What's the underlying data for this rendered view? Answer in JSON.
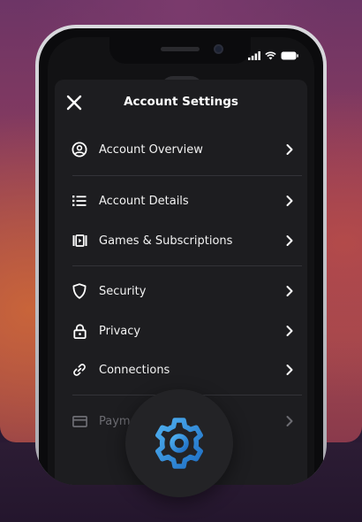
{
  "screen": {
    "title": "Account Settings",
    "menu": [
      {
        "label": "Account Overview",
        "icon": "account-circle-icon"
      },
      {
        "label": "Account Details",
        "icon": "list-icon"
      },
      {
        "label": "Games & Subscriptions",
        "icon": "games-icon"
      },
      {
        "label": "Security",
        "icon": "shield-icon"
      },
      {
        "label": "Privacy",
        "icon": "lock-icon"
      },
      {
        "label": "Connections",
        "icon": "link-icon"
      },
      {
        "label": "Payme",
        "icon": "credit-card-icon"
      }
    ]
  },
  "colors": {
    "accent_gear": "#2d8fd8",
    "sheet_bg": "#1d1d20",
    "text": "#f2f2f2",
    "faded_text": "#6c6c72"
  }
}
